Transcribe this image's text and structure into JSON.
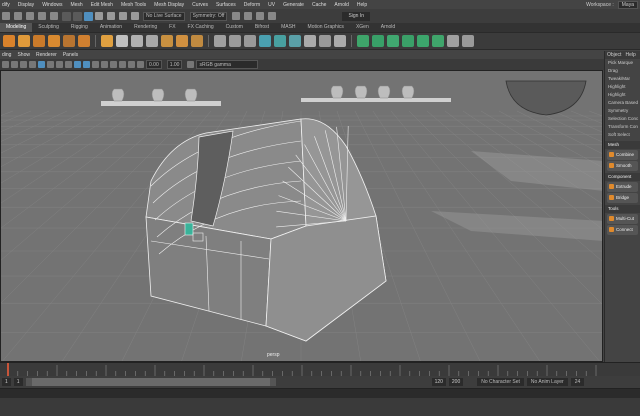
{
  "menubar": {
    "items": [
      "dify",
      "Display",
      "Windows",
      "Mesh",
      "Edit Mesh",
      "Mesh Tools",
      "Mesh Display",
      "Curves",
      "Surfaces",
      "Deform",
      "UV",
      "Generate",
      "Cache",
      "Arnold",
      "Help"
    ],
    "workspace_label": "Workspace :",
    "workspace_value": "Maya"
  },
  "statusline": {
    "field_value": "No Live Surface",
    "symmetry": "Symmetry: Off",
    "sign_in": "Sign In"
  },
  "shelf_tabs": [
    "Modeling",
    "Sculpting",
    "Rigging",
    "Animation",
    "Rendering",
    "FX",
    "FX Caching",
    "Custom",
    "Bifrost",
    "MASH",
    "Motion Graphics",
    "XGen",
    "Arnold"
  ],
  "active_shelf_tab": "Modeling",
  "panel_menu": [
    "ding",
    "Show",
    "Renderer",
    "Panels"
  ],
  "view_tools": {
    "value_a": "0.00",
    "value_b": "1.00",
    "color_space": "sRGB gamma"
  },
  "viewport": {
    "camera_label": "persp",
    "background_color": "#737373"
  },
  "right_panel": {
    "tabs": [
      "Object",
      "Help"
    ],
    "rows": [
      {
        "type": "row",
        "label": "Pick Marque"
      },
      {
        "type": "row",
        "label": "Drag"
      },
      {
        "type": "row",
        "label": "Tweak/Mar"
      },
      {
        "type": "row",
        "label": "Highlight"
      },
      {
        "type": "row",
        "label": "Highlight"
      },
      {
        "type": "row",
        "label": "Camera Based"
      },
      {
        "type": "row",
        "label": "Symmetry"
      },
      {
        "type": "row",
        "label": "Selection Conc"
      },
      {
        "type": "row",
        "label": "Transform Con"
      },
      {
        "type": "row",
        "label": "Soft Select"
      },
      {
        "type": "section",
        "label": "Mesh"
      },
      {
        "type": "button",
        "label": "Combine"
      },
      {
        "type": "button",
        "label": "Smooth"
      },
      {
        "type": "section",
        "label": "Component"
      },
      {
        "type": "button",
        "label": "Extrude"
      },
      {
        "type": "button",
        "label": "Bridge"
      },
      {
        "type": "section",
        "label": "Tools"
      },
      {
        "type": "button",
        "label": "Multi-Cut"
      },
      {
        "type": "button",
        "label": "Connect"
      }
    ]
  },
  "range": {
    "start": "1",
    "playback_start": "1",
    "playback_end": "120",
    "end": "120",
    "anim_end": "200",
    "character_set": "No Character Set",
    "anim_layer": "No Anim Layer",
    "fps": "24"
  },
  "timeline": {
    "current_frame": "1"
  }
}
